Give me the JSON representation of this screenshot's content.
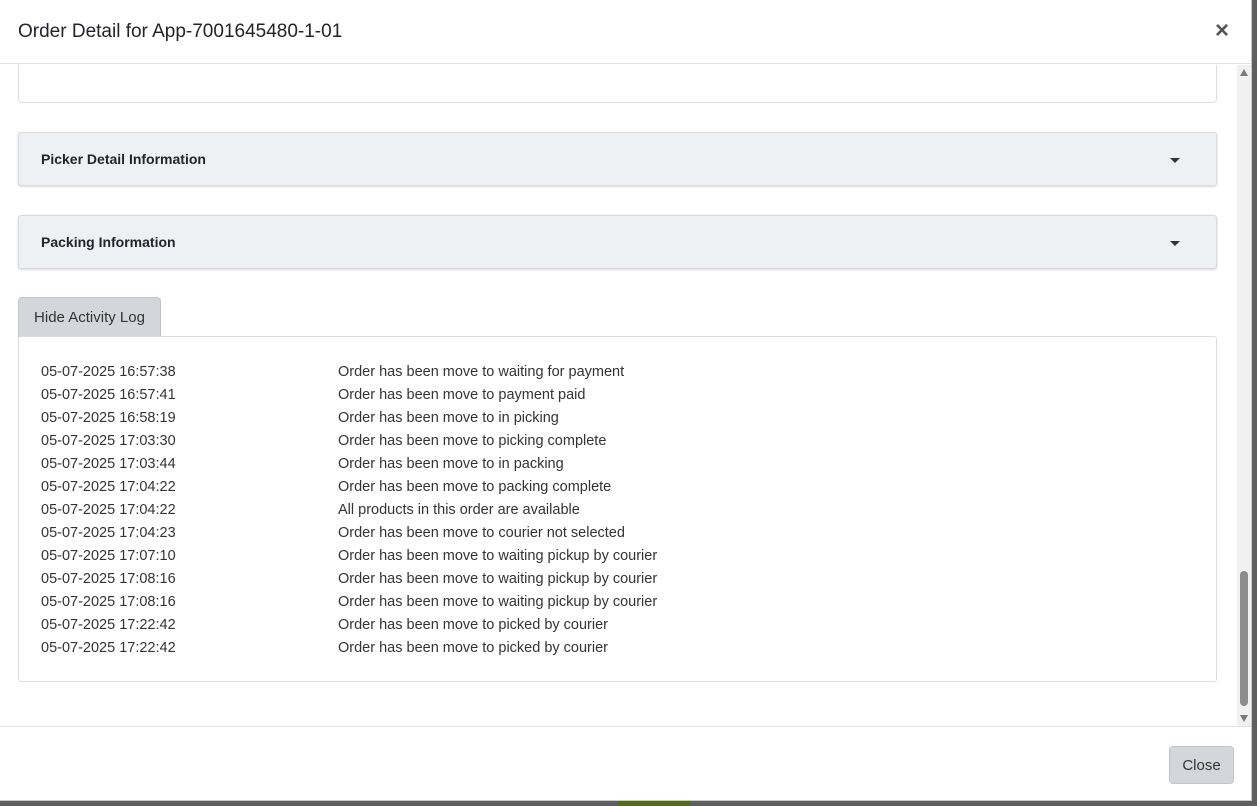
{
  "modal": {
    "title": "Order Detail for App-7001645480-1-01",
    "close_icon": "×"
  },
  "sections": {
    "picker_title": "Picker Detail Information",
    "packing_title": "Packing Information"
  },
  "activity_log": {
    "toggle_label": "Hide Activity Log",
    "entries": [
      {
        "time": "05-07-2025 16:57:38",
        "message": "Order has been move to waiting for payment"
      },
      {
        "time": "05-07-2025 16:57:41",
        "message": "Order has been move to payment paid"
      },
      {
        "time": "05-07-2025 16:58:19",
        "message": "Order has been move to in picking"
      },
      {
        "time": "05-07-2025 17:03:30",
        "message": "Order has been move to picking complete"
      },
      {
        "time": "05-07-2025 17:03:44",
        "message": "Order has been move to in packing"
      },
      {
        "time": "05-07-2025 17:04:22",
        "message": "Order has been move to packing complete"
      },
      {
        "time": "05-07-2025 17:04:22",
        "message": "All products in this order are available"
      },
      {
        "time": "05-07-2025 17:04:23",
        "message": "Order has been move to courier not selected"
      },
      {
        "time": "05-07-2025 17:07:10",
        "message": "Order has been move to waiting pickup by courier"
      },
      {
        "time": "05-07-2025 17:08:16",
        "message": "Order has been move to waiting pickup by courier"
      },
      {
        "time": "05-07-2025 17:08:16",
        "message": "Order has been move to waiting pickup by courier"
      },
      {
        "time": "05-07-2025 17:22:42",
        "message": "Order has been move to picked by courier"
      },
      {
        "time": "05-07-2025 17:22:42",
        "message": "Order has been move to picked by courier"
      }
    ]
  },
  "footer": {
    "close_label": "Close"
  },
  "icons": {
    "close": "close-icon",
    "caret": "caret-down-icon"
  }
}
